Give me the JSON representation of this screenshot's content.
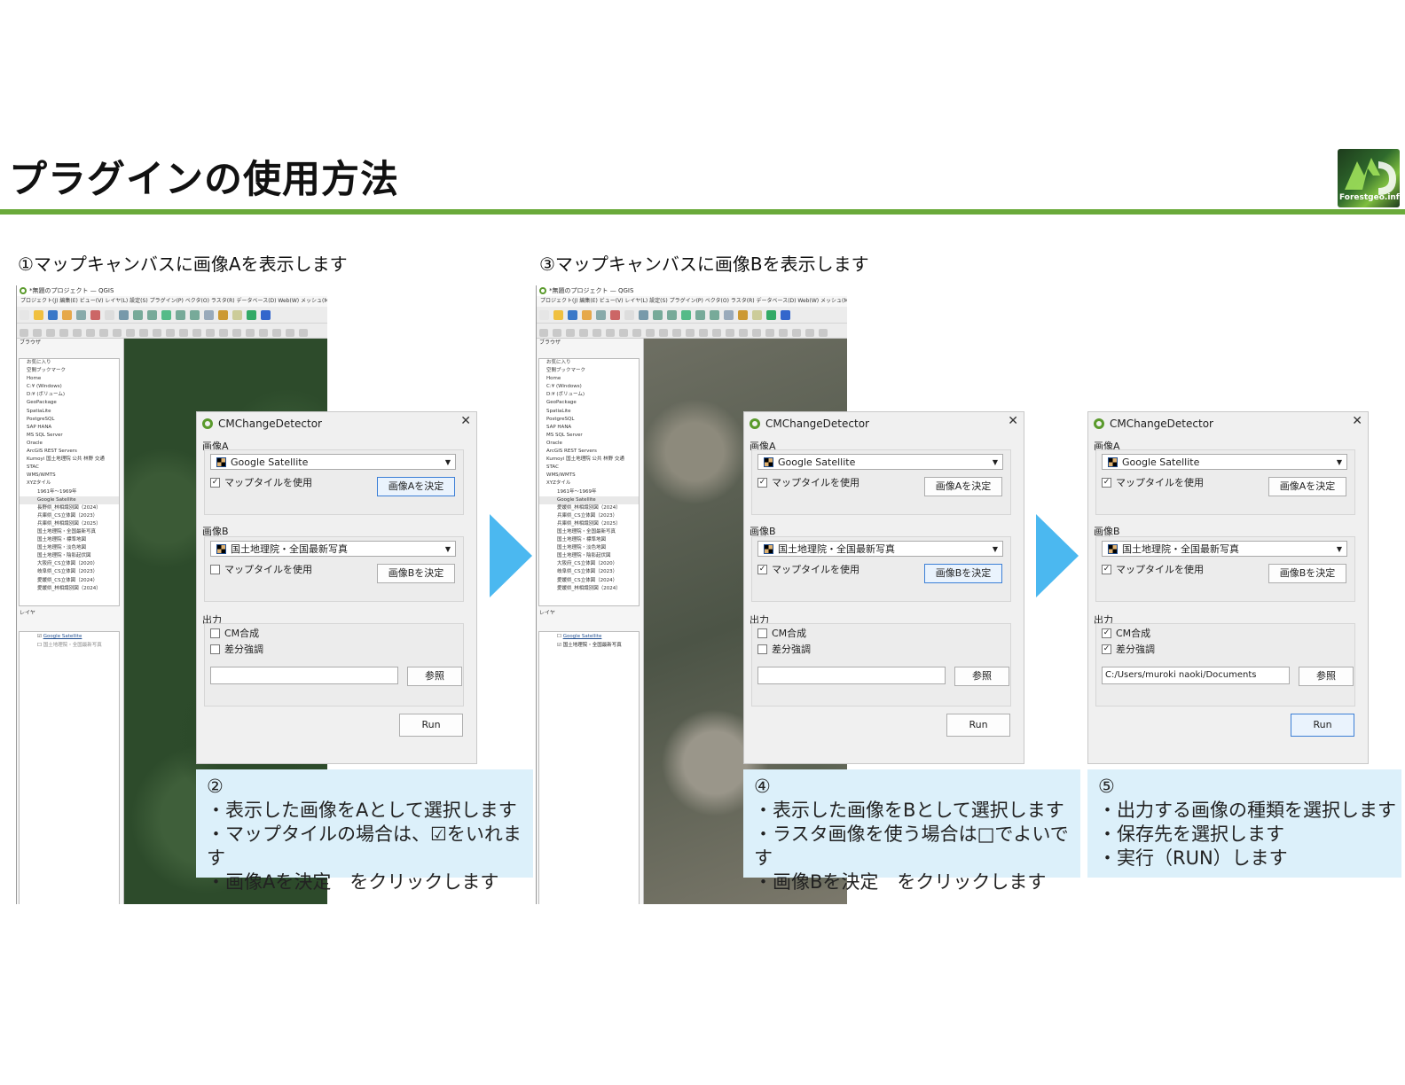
{
  "slide": {
    "title": "プラグインの使用方法",
    "logo_text": "Forestgeo.info"
  },
  "steps": {
    "step1_heading": "①マップキャンバスに画像Aを表示します",
    "step3_heading": "③マップキャンバスに画像Bを表示します"
  },
  "qgis": {
    "window_title": "*無題のプロジェクト — QGIS",
    "menu": "プロジェクト(J)  編集(E)  ビュー(V)  レイヤ(L)  設定(S)  プラグイン(P)  ベクタ(O)  ラスタ(R)  データベース(D)  Web(W)  メッシュ(M)",
    "browser_title": "ブラウザ",
    "layers_title": "レイヤ",
    "browser_items_a": [
      "お気に入り",
      "空間ブックマーク",
      "Home",
      "C:¥ (Windows)",
      "D:¥ (ボリューム)",
      "GeoPackage",
      "SpatiaLite",
      "PostgreSQL",
      "SAP HANA",
      "MS SQL Server",
      "Oracle",
      "ArcGIS REST Servers",
      "Kumoyi 国土地理院 公共 林野  交通",
      "STAC",
      "WMS/WMTS",
      "XYZタイル"
    ],
    "xyz_items_a": [
      "1961年～1969年",
      "Google Satellite",
      "長野県_林相識別図（2024）",
      "兵庫県_CS立体図（2023）",
      "兵庫県_林相識別図（2025）",
      "国土地理院・全国最新写真",
      "国土地理院・標準地図",
      "国土地理院・淡色地図",
      "国土地理院・陰影起伏図",
      "大阪府_CS立体図（2020）",
      "岐阜県_CS立体図（2023）",
      "愛媛県_CS立体図（2024）",
      "愛媛県_林相識別図（2024）"
    ],
    "browser_items_b": [
      "お気に入り",
      "空間ブックマーク",
      "Home",
      "C:¥ (Windows)",
      "D:¥ (ボリューム)",
      "GeoPackage",
      "SpatiaLite",
      "PostgreSQL",
      "SAP HANA",
      "MS SQL Server",
      "Oracle",
      "ArcGIS REST Servers",
      "Kumoyi 国土地理院 公共 林野 交通",
      "STAC",
      "WMS/WMTS",
      "XYZタイル"
    ],
    "xyz_items_b": [
      "1961年～1969年",
      "Google Satellite",
      "愛媛県_林相識別図（2024）",
      "兵庫県_CS立体図（2023）",
      "兵庫県_林相識別図（2025）",
      "国土地理院・全国最新写真",
      "国土地理院・標準地図",
      "国土地理院・淡色地図",
      "国土地理院・陰影起伏図",
      "大阪府_CS立体図（2020）",
      "岐阜県_CS立体図（2023）",
      "愛媛県_CS立体図（2024）",
      "愛媛県_林相識別図（2024）"
    ],
    "layer1": "Google Satellite",
    "layer2": "国土地理院・全国最新写真"
  },
  "dialog": {
    "title": "CMChangeDetector",
    "image_a_label": "画像A",
    "image_b_label": "画像B",
    "output_label": "出力",
    "combo_a": "Google Satellite",
    "combo_b": "国土地理院・全国最新写真",
    "use_map_tile": "マップタイルを使用",
    "decide_a": "画像Aを決定",
    "decide_b": "画像Bを決定",
    "cm_composite": "CM合成",
    "diff_enhance": "差分強調",
    "browse": "参照",
    "run": "Run",
    "output_path": "C:/Users/muroki naoki/Documents"
  },
  "notes": {
    "n2_num": "②",
    "n2_l1": "・表示した画像をAとして選択します",
    "n2_l2": "・マップタイルの場合は、☑をいれます",
    "n2_l3": "・画像Aを決定　をクリックします",
    "n4_num": "④",
    "n4_l1": "・表示した画像をBとして選択します",
    "n4_l2": "・ラスタ画像を使う場合は□でよいです",
    "n4_l3": "・画像Bを決定　をクリックします",
    "n5_num": "⑤",
    "n5_l1": "・出力する画像の種類を選択します",
    "n5_l2": "・保存先を選択します",
    "n5_l3": "・実行（RUN）します"
  },
  "colors": {
    "accent_green": "#6aaa3a",
    "arrow_blue": "#4bb8f0",
    "note_bg": "#dcf0fa"
  }
}
